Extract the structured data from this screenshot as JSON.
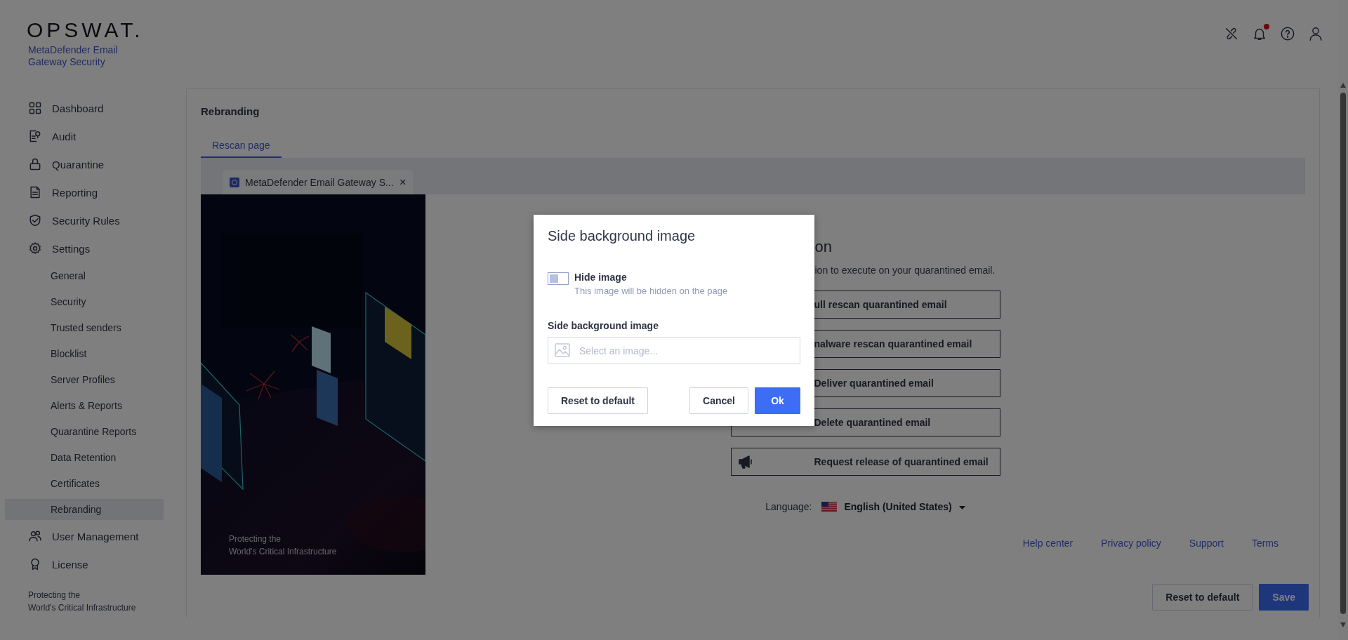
{
  "header": {
    "logo": "OPSWAT.",
    "product": "MetaDefender Email Gateway Security",
    "actions": [
      {
        "kind": "link-off",
        "unread": false
      },
      {
        "kind": "bell",
        "unread": true
      },
      {
        "kind": "help",
        "unread": false
      },
      {
        "kind": "user",
        "unread": false
      }
    ]
  },
  "sidebar": {
    "items": [
      {
        "label": "Dashboard",
        "kind": "grid",
        "selected": false
      },
      {
        "label": "Audit",
        "kind": "audit",
        "selected": false
      },
      {
        "label": "Quarantine",
        "kind": "lock",
        "selected": false
      },
      {
        "label": "Reporting",
        "kind": "document",
        "selected": false
      },
      {
        "label": "Security Rules",
        "kind": "shield",
        "selected": false
      },
      {
        "label": "Settings",
        "kind": "gear",
        "selected": false,
        "children": [
          {
            "label": "General",
            "selected": false
          },
          {
            "label": "Security",
            "selected": false
          },
          {
            "label": "Trusted senders",
            "selected": false
          },
          {
            "label": "Blocklist",
            "selected": false
          },
          {
            "label": "Server Profiles",
            "selected": false
          },
          {
            "label": "Alerts & Reports",
            "selected": false
          },
          {
            "label": "Quarantine Reports",
            "selected": false
          },
          {
            "label": "Data Retention",
            "selected": false
          },
          {
            "label": "Certificates",
            "selected": false
          },
          {
            "label": "Rebranding",
            "selected": true
          }
        ]
      },
      {
        "label": "User Management",
        "kind": "users",
        "selected": false
      },
      {
        "label": "License",
        "kind": "award",
        "selected": false
      }
    ],
    "tagline": [
      "Protecting the",
      "World's Critical Infrastructure"
    ]
  },
  "page": {
    "title": "Rebranding",
    "tabs": [
      {
        "label": "Rescan page",
        "selected": true
      }
    ],
    "preview": {
      "browser_tab": {
        "title": "MetaDefender Email Gateway S...",
        "close": "×"
      },
      "side_image": {
        "kind": "picture",
        "caption": [
          "Protecting the",
          "World's Critical Infrastructure"
        ]
      },
      "heading": "on",
      "description": "ion to execute on your quarantined email.",
      "actions": [
        {
          "label": "ull rescan quarantined email",
          "kind": "plain"
        },
        {
          "label": "nalware rescan quarantined email",
          "kind": "plain"
        },
        {
          "label": "Deliver quarantined email",
          "kind": "plain"
        },
        {
          "label": "Delete quarantined email",
          "kind": "plain"
        },
        {
          "label": "Request release of quarantined email",
          "kind": "megaphone"
        }
      ],
      "language": {
        "label": "Language:",
        "value": "English (United States)"
      },
      "links": [
        "Help center",
        "Privacy policy",
        "Support",
        "Terms"
      ]
    },
    "buttons": [
      {
        "label": "Reset to default",
        "kind": "secondary"
      },
      {
        "label": "Save",
        "kind": "primary"
      }
    ]
  },
  "dialog": {
    "title": "Side background image",
    "toggle": {
      "label": "Hide image",
      "description": "This image will be hidden on the page",
      "on": false
    },
    "field": {
      "label": "Side background image",
      "placeholder": "Select an image..."
    },
    "buttons": [
      {
        "label": "Reset to default",
        "kind": "secondary"
      },
      {
        "label": "Cancel",
        "kind": "secondary"
      },
      {
        "label": "Ok",
        "kind": "primary"
      }
    ]
  }
}
